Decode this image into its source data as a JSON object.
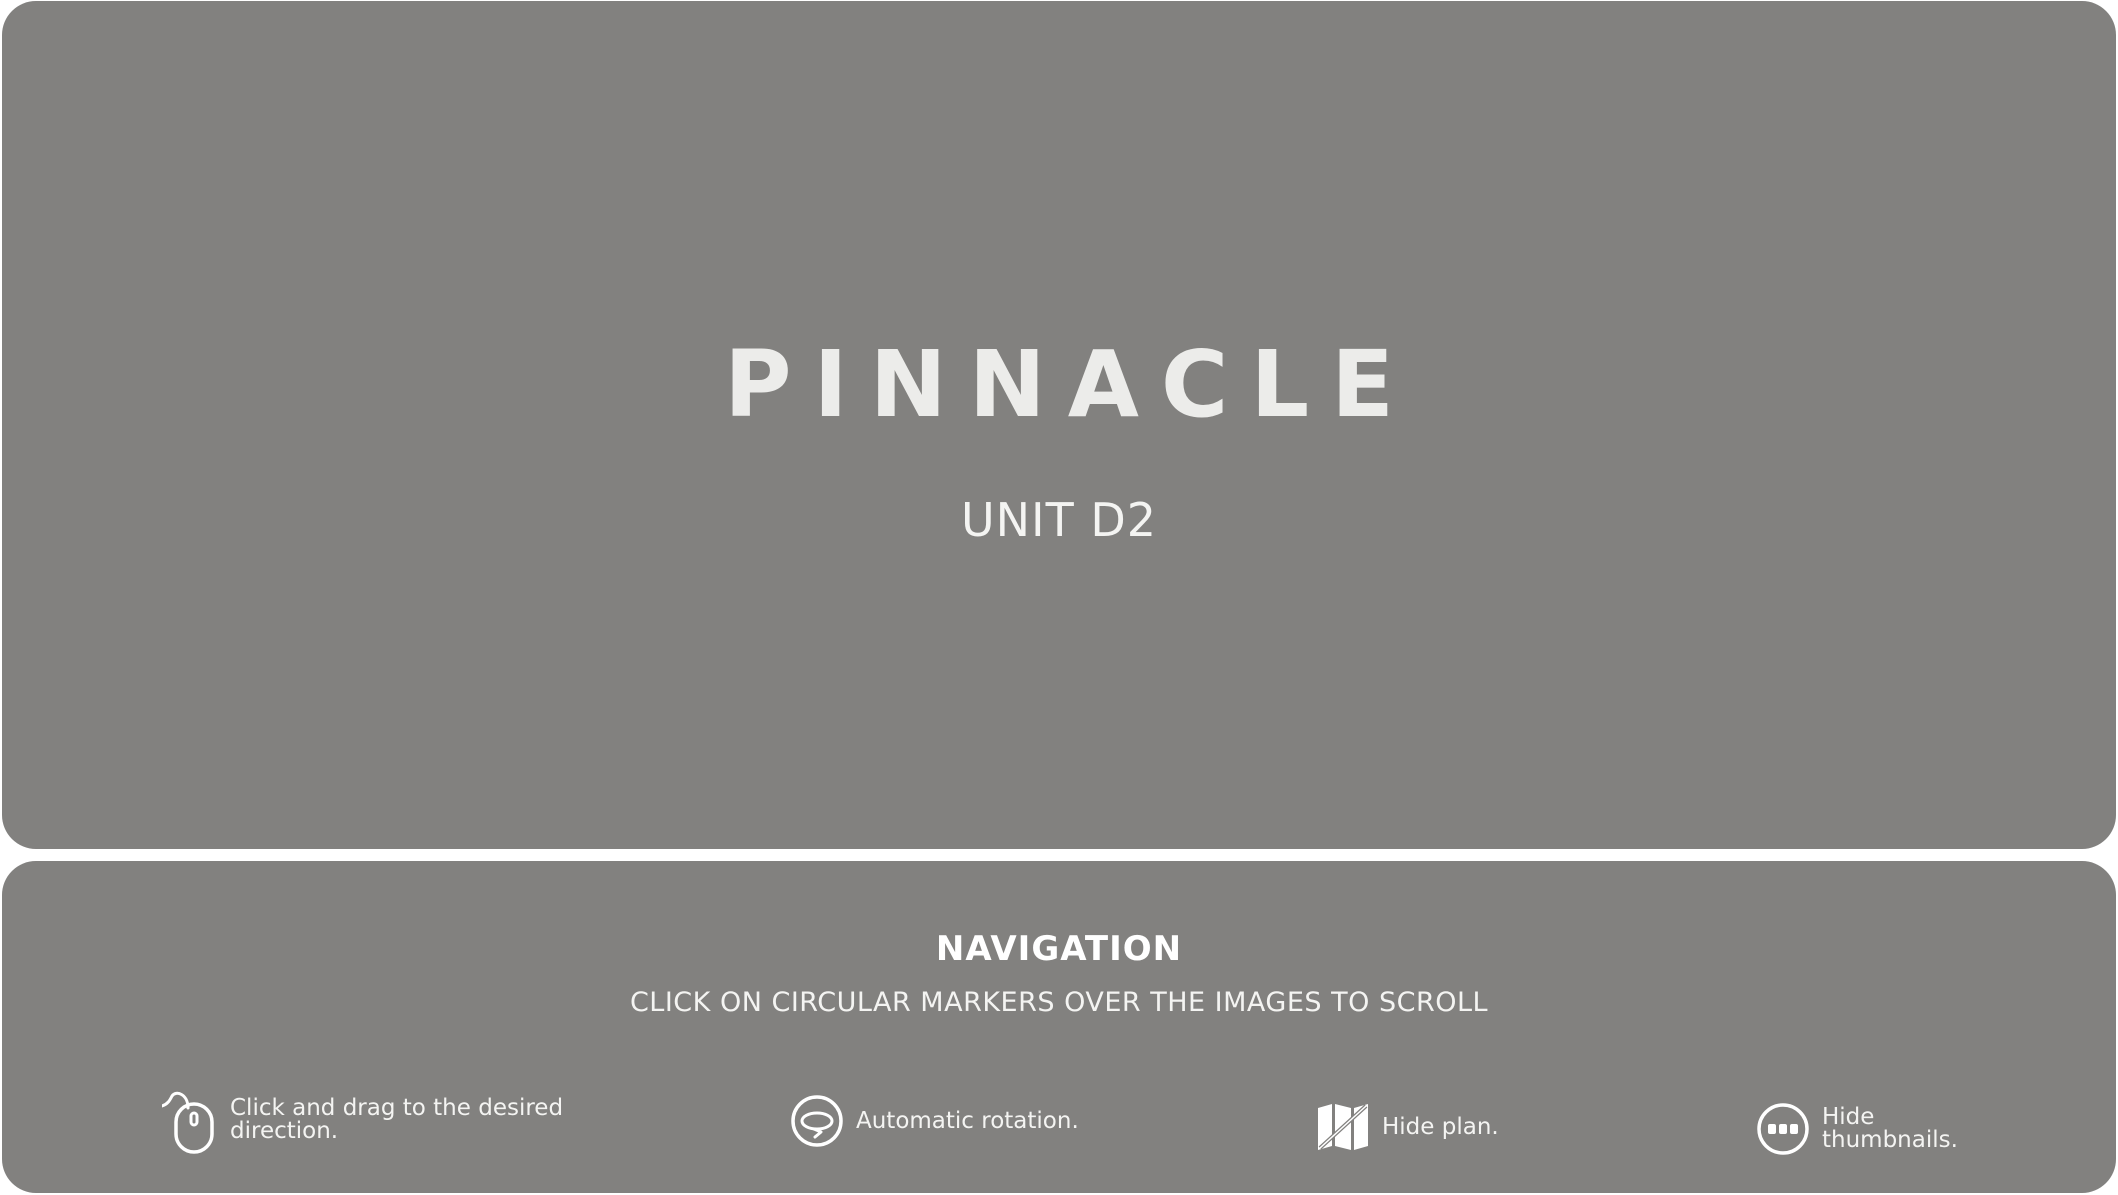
{
  "intro": {
    "brand": "PINNACLE",
    "unit": "UNIT D2"
  },
  "navigation": {
    "title": "NAVIGATION",
    "subtitle": "CLICK ON CIRCULAR MARKERS OVER THE IMAGES TO SCROLL",
    "hints": [
      {
        "icon": "mouse-icon",
        "label": "Click and drag to the desired\ndirection."
      },
      {
        "icon": "rotation-icon",
        "label": "Automatic rotation."
      },
      {
        "icon": "map-icon",
        "label": "Hide plan."
      },
      {
        "icon": "thumbnails-icon",
        "label": "Hide\nthumbnails."
      }
    ]
  },
  "colors": {
    "panel": "#82817f",
    "text": "#f4f4f2",
    "background": "#ffffff"
  }
}
